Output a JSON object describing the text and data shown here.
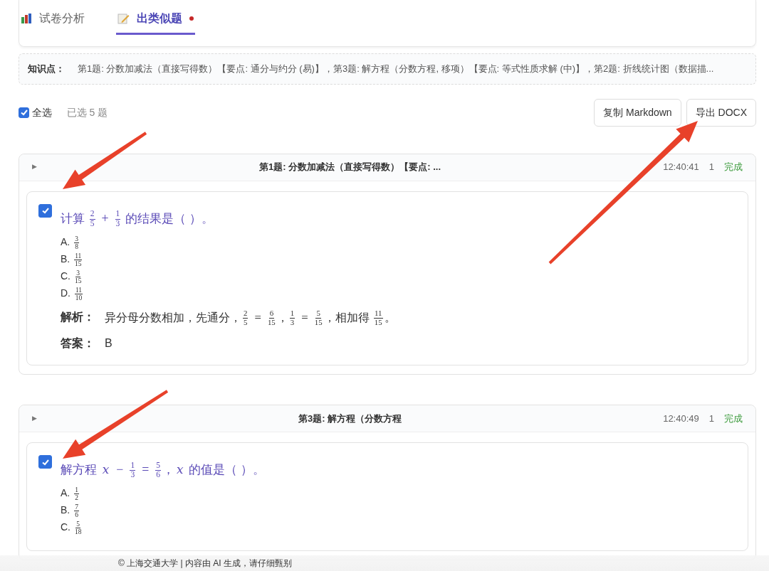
{
  "tabs": [
    {
      "label": "试卷分析",
      "selected": false,
      "dot": false
    },
    {
      "label": "出类似题",
      "selected": true,
      "dot": true
    }
  ],
  "knowledge": {
    "label": "知识点：",
    "text": "第1题: 分数加减法（直接写得数）【要点: 通分与约分 (易)】，第3题: 解方程（分数方程, 移项）【要点: 等式性质求解 (中)】，第2题: 折线统计图（数据描..."
  },
  "toolbar": {
    "select_all": {
      "label": "全选",
      "checked": true
    },
    "selected_count": "已选 5 题",
    "buttons": [
      "复制 Markdown",
      "导出 DOCX"
    ]
  },
  "questions": [
    {
      "toggle": "▶",
      "title": "第1题: 分数加减法（直接写得数）【要点: ...",
      "time": "12:40:41",
      "count": "1",
      "status": "完成",
      "checked": true,
      "stem": [
        {
          "kind": "text",
          "text": "计算 "
        },
        {
          "kind": "frac",
          "num": "2",
          "den": "5"
        },
        {
          "kind": "op",
          "text": "+"
        },
        {
          "kind": "frac",
          "num": "1",
          "den": "3"
        },
        {
          "kind": "text",
          "text": " 的结果是（ ）。"
        }
      ],
      "options": [
        {
          "letter": "A.",
          "content": [
            {
              "kind": "frac",
              "num": "3",
              "den": "8"
            }
          ]
        },
        {
          "letter": "B.",
          "content": [
            {
              "kind": "frac",
              "num": "11",
              "den": "15"
            }
          ]
        },
        {
          "letter": "C.",
          "content": [
            {
              "kind": "frac",
              "num": "3",
              "den": "15"
            }
          ]
        },
        {
          "letter": "D.",
          "content": [
            {
              "kind": "frac",
              "num": "11",
              "den": "10"
            }
          ]
        }
      ],
      "analysis_label": "解析：",
      "analysis": [
        {
          "kind": "text",
          "text": "异分母分数相加，先通分，"
        },
        {
          "kind": "frac",
          "num": "2",
          "den": "5"
        },
        {
          "kind": "op",
          "text": "="
        },
        {
          "kind": "frac",
          "num": "6",
          "den": "15"
        },
        {
          "kind": "text",
          "text": "，"
        },
        {
          "kind": "frac",
          "num": "1",
          "den": "3"
        },
        {
          "kind": "op",
          "text": "="
        },
        {
          "kind": "frac",
          "num": "5",
          "den": "15"
        },
        {
          "kind": "text",
          "text": "，相加得 "
        },
        {
          "kind": "frac",
          "num": "11",
          "den": "15"
        },
        {
          "kind": "text",
          "text": "。"
        }
      ],
      "answer_label": "答案：",
      "answer": "B"
    },
    {
      "toggle": "▶",
      "title": "第3题: 解方程（分数方程",
      "time": "12:40:49",
      "count": "1",
      "status": "完成",
      "checked": true,
      "stem": [
        {
          "kind": "text",
          "text": "解方程 "
        },
        {
          "kind": "var",
          "text": "x"
        },
        {
          "kind": "op",
          "text": "−"
        },
        {
          "kind": "frac",
          "num": "1",
          "den": "3"
        },
        {
          "kind": "op",
          "text": "="
        },
        {
          "kind": "frac",
          "num": "5",
          "den": "6"
        },
        {
          "kind": "text",
          "text": "，"
        },
        {
          "kind": "var",
          "text": "x"
        },
        {
          "kind": "text",
          "text": " 的值是（ ）。"
        }
      ],
      "options": [
        {
          "letter": "A.",
          "content": [
            {
              "kind": "frac",
              "num": "1",
              "den": "2"
            }
          ]
        },
        {
          "letter": "B.",
          "content": [
            {
              "kind": "frac",
              "num": "7",
              "den": "6"
            }
          ]
        },
        {
          "letter": "C.",
          "content": [
            {
              "kind": "frac",
              "num": "5",
              "den": "18"
            }
          ]
        }
      ]
    }
  ],
  "footer": "© 上海交通大学 | 内容由 AI 生成，请仔细甄别"
}
